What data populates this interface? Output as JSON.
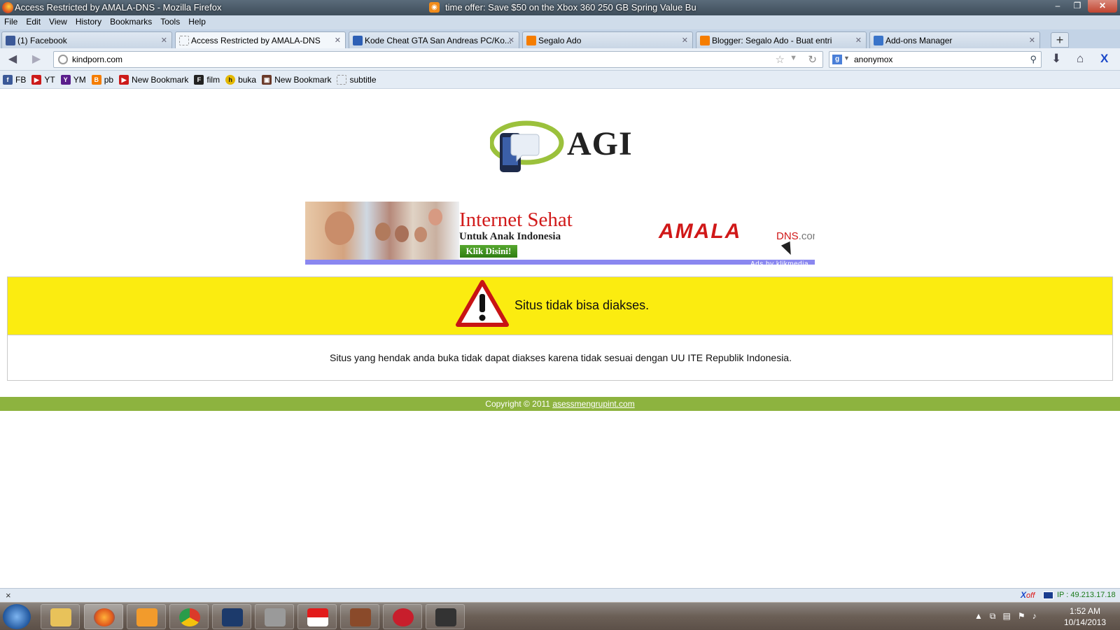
{
  "window": {
    "title": "Access Restricted by AMALA-DNS - Mozilla Firefox",
    "ticker": "time offer: Save $50 on the Xbox 360 250 GB Spring Value Bu",
    "minimize": "–",
    "restore": "❐",
    "close": "✕"
  },
  "menu": [
    "File",
    "Edit",
    "View",
    "History",
    "Bookmarks",
    "Tools",
    "Help"
  ],
  "tabs": [
    {
      "label": "(1) Facebook",
      "icon": "facebook-icon",
      "color": "#3b5998"
    },
    {
      "label": "Access Restricted by AMALA-DNS",
      "icon": "blank-page-icon",
      "color": "#ffffff"
    },
    {
      "label": "Kode Cheat GTA San Andreas PC/Ko...",
      "icon": "document-icon",
      "color": "#2d5fb5"
    },
    {
      "label": "Segalo Ado",
      "icon": "blogger-icon",
      "color": "#f57d00"
    },
    {
      "label": "Blogger: Segalo Ado - Buat entri",
      "icon": "blogger-icon",
      "color": "#f57d00"
    },
    {
      "label": "Add-ons Manager",
      "icon": "puzzle-icon",
      "color": "#3a74c9"
    }
  ],
  "tab_close": "✕",
  "new_tab": "+",
  "nav": {
    "url": "kindporn.com",
    "search_query": "anonymox"
  },
  "bookmarks": [
    {
      "label": "FB",
      "icon": "facebook-icon",
      "color": "#3b5998",
      "glyph": "f"
    },
    {
      "label": "YT",
      "icon": "youtube-icon",
      "color": "#cc1b1b",
      "glyph": "▶"
    },
    {
      "label": "YM",
      "icon": "yahoo-icon",
      "color": "#5a1e8c",
      "glyph": "Y"
    },
    {
      "label": "pb",
      "icon": "blogger-icon",
      "color": "#f57d00",
      "glyph": "B"
    },
    {
      "label": "New Bookmark",
      "icon": "youtube-icon",
      "color": "#cc1b1b",
      "glyph": "▶"
    },
    {
      "label": "film",
      "icon": "film-icon",
      "color": "#222222",
      "glyph": "F"
    },
    {
      "label": "buka",
      "icon": "h-icon",
      "color": "#e3b800",
      "glyph": "h"
    },
    {
      "label": "New Bookmark",
      "icon": "site-icon",
      "color": "#6a3a2a",
      "glyph": "▣"
    },
    {
      "label": "subtitle",
      "icon": "blank-page-icon",
      "color": "#ffffff",
      "glyph": ""
    }
  ],
  "page": {
    "logo_text": "AGI",
    "banner": {
      "headline": "Internet Sehat",
      "subline": "Untuk Anak Indonesia",
      "button": "Klik Disini!",
      "brand": "AMALA",
      "brand_suffix": "DNS",
      "brand_tld": ".com",
      "ads_by": "Ads by klikmedia"
    },
    "warning": "Situs tidak bisa diakses.",
    "message": "Situs yang hendak anda buka tidak dapat diakses karena tidak sesuai dengan UU ITE Republik Indonesia.",
    "footer_prefix": "Copyright © 2011",
    "footer_link": "asessmengrupint.com"
  },
  "statusbar": {
    "close": "×",
    "xoff_x": "X",
    "xoff_label": "off",
    "ip": "IP : 49.213.17.18"
  },
  "taskbar": {
    "time": "1:52 AM",
    "date": "10/14/2013"
  },
  "colors": {
    "warning_bg": "#fbec10",
    "footer_bg": "#8db33f",
    "banner_strip": "#8a87f0",
    "brand_red": "#d01818"
  }
}
